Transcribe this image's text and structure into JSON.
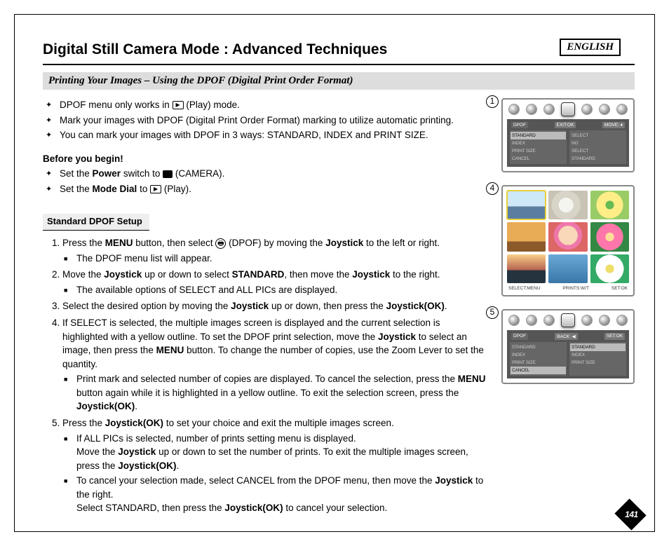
{
  "lang": "ENGLISH",
  "title": "Digital Still Camera Mode : Advanced Techniques",
  "subtitle": "Printing Your Images – Using the DPOF (Digital Print Order Format)",
  "intro": {
    "i0a": "DPOF menu only works in ",
    "i0b": "(Play) mode.",
    "i1": "Mark your images with DPOF (Digital Print Order Format) marking to utilize automatic printing.",
    "i2": "You can mark your images with DPOF in 3 ways: STANDARD, INDEX and PRINT SIZE."
  },
  "before": {
    "head": "Before you begin!",
    "b0a": "Set the ",
    "b0b": "Power",
    "b0c": " switch to ",
    "b0d": "(CAMERA).",
    "b1a": "Set the ",
    "b1b": "Mode Dial",
    "b1c": " to ",
    "b1d": "(Play)."
  },
  "section_label": "Standard DPOF Setup",
  "steps": {
    "s1a": "Press the ",
    "s1b": "MENU",
    "s1c": " button, then select  ",
    "s1d": "(DPOF) by moving the ",
    "s1e": "Joystick",
    "s1f": " to the left or right.",
    "s1sub": "The DPOF menu list will appear.",
    "s2a": "Move the ",
    "s2b": "Joystick",
    "s2c": " up or down to select ",
    "s2d": "STANDARD",
    "s2e": ", then move the ",
    "s2f": "Joystick",
    "s2g": " to the right.",
    "s2sub": "The available options of SELECT and ALL PICs are displayed.",
    "s3a": "Select the desired option by moving the ",
    "s3b": "Joystick",
    "s3c": " up or down, then press the ",
    "s3d": "Joystick(OK)",
    "s3e": ".",
    "s4a": "If SELECT is selected, the multiple images screen is displayed and the current selection is highlighted with a yellow outline. To set the DPOF print selection, move the ",
    "s4b": "Joystick",
    "s4c": " to select an image, then press the ",
    "s4d": "MENU",
    "s4e": " button. To change the number of copies, use the Zoom Lever to set the quantity.",
    "s4sub_a": "Print mark and selected number of copies are displayed. To cancel the selection, press the ",
    "s4sub_b": "MENU",
    "s4sub_c": " button again while it is highlighted in a yellow outline. To exit the selection screen, press the ",
    "s4sub_d": "Joystick(OK)",
    "s4sub_e": ".",
    "s5a": "Press the ",
    "s5b": "Joystick(OK)",
    "s5c": " to set your choice and exit the multiple images screen.",
    "s5sub1_a": "If ALL PICs is selected, number of prints setting menu is displayed.",
    "s5sub1_b": "Move the ",
    "s5sub1_c": "Joystick",
    "s5sub1_d": " up or down to set the number of prints. To exit the multiple images screen, press the ",
    "s5sub1_e": "Joystick(OK)",
    "s5sub1_f": ".",
    "s5sub2_a": "To cancel your selection made, select CANCEL from the DPOF menu, then move the ",
    "s5sub2_b": "Joystick",
    "s5sub2_c": " to the right.",
    "s5sub2_d": "Select STANDARD, then press the ",
    "s5sub2_e": "Joystick(OK)",
    "s5sub2_f": " to cancel your selection."
  },
  "fig1": {
    "num": "1",
    "hdr_left": "DPOF",
    "hdr_mid": "EXIT:OK",
    "hdr_right": "MOVE:",
    "l0": "STANDARD",
    "l1": "INDEX",
    "l2": "PRINT SIZE",
    "l3": "CANCEL",
    "r0": "SELECT",
    "r1": "NO",
    "r2": "SELECT",
    "r3": "STANDARD"
  },
  "fig4": {
    "num": "4",
    "f0": "SELECT:MENU",
    "f1": "PRINTS:W/T",
    "f2": "SET:OK"
  },
  "fig5": {
    "num": "5",
    "hdr_left": "DPOF",
    "hdr_mid": "BACK:",
    "hdr_right": "SET:OK",
    "l0": "STANDARD",
    "l1": "INDEX",
    "l2": "PRINT SIZE",
    "l3": "CANCEL",
    "r0": "STANDARD",
    "r1": "INDEX",
    "r2": "PRINT SIZE"
  },
  "page_num": "141"
}
